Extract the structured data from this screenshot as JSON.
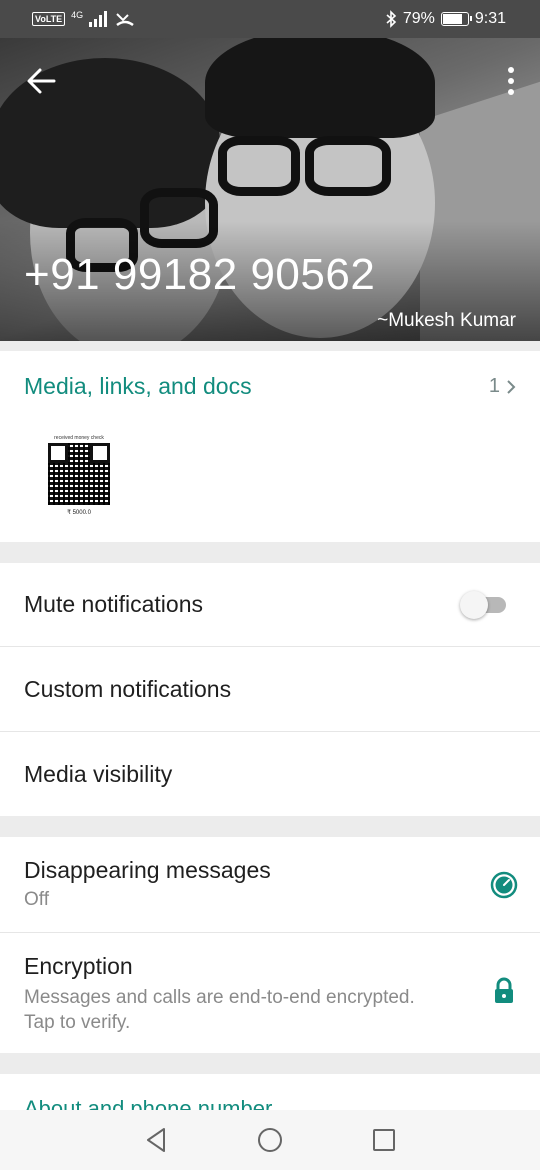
{
  "status_bar": {
    "carrier_badge": "VoLTE",
    "network": "4G",
    "battery": "79%",
    "battery_level": 0.79,
    "time": "9:31"
  },
  "header": {
    "phone_number": "+91 99182 90562",
    "push_name": "~Mukesh Kumar"
  },
  "media": {
    "title": "Media, links, and docs",
    "count": "1",
    "thumbnail": {
      "caption": "received money check",
      "amount": "₹ 5000.0"
    }
  },
  "notifications": {
    "mute_label": "Mute notifications",
    "mute_on": false,
    "custom_label": "Custom notifications",
    "media_visibility_label": "Media visibility"
  },
  "privacy": {
    "disappearing_label": "Disappearing messages",
    "disappearing_value": "Off",
    "encryption_label": "Encryption",
    "encryption_desc_line1": "Messages and calls are end-to-end encrypted.",
    "encryption_desc_line2": "Tap to verify."
  },
  "about": {
    "label": "About and phone number"
  },
  "colors": {
    "accent": "#128c7e",
    "status_bar": "#4a4a4a",
    "divider": "#ececec"
  },
  "icons": {
    "back": "arrow-left",
    "menu": "more-vertical",
    "disappearing": "timer-circle",
    "encryption": "lock",
    "nav_back": "triangle-left",
    "nav_home": "circle",
    "nav_recents": "square"
  }
}
